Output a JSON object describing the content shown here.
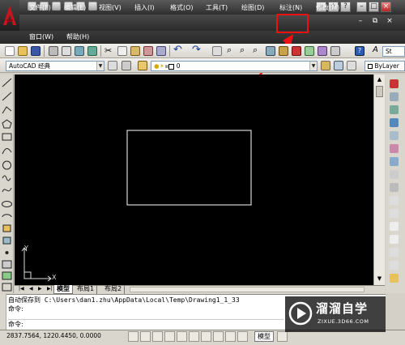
{
  "app": {
    "logo_letter": "A"
  },
  "menus": [
    {
      "label": "文件(F)"
    },
    {
      "label": "编辑(E)"
    },
    {
      "label": "视图(V)"
    },
    {
      "label": "插入(I)"
    },
    {
      "label": "格式(O)"
    },
    {
      "label": "工具(T)"
    },
    {
      "label": "绘图(D)"
    },
    {
      "label": "标注(N)"
    },
    {
      "label": "修改(M)"
    }
  ],
  "menus_row2": [
    {
      "label": "窗口(W)"
    },
    {
      "label": "帮助(H)"
    }
  ],
  "toolbar": {
    "workspace": "AutoCAD 经典",
    "layer": "0",
    "linetype": "ByLayer",
    "style_partial": "St"
  },
  "layout_tabs": [
    "模型",
    "布局1",
    "布局2"
  ],
  "command": {
    "line1": "自动保存到 C:\\Users\\dan1.zhu\\AppData\\Local\\Temp\\Drawing1_1_33",
    "line2": "命令:",
    "prompt": "命令:"
  },
  "status": {
    "coords": "2837.7564,  1220.4450, 0.0000",
    "model_label": "模型"
  },
  "ucs": {
    "y": "Y",
    "x": "X"
  },
  "watermark": {
    "brand": "溜溜自学",
    "url": "ZIXUE.3D66.COM"
  },
  "colors": {
    "highlight": "#e11111",
    "canvas": "#000000",
    "drawing_line": "#ffffff"
  }
}
